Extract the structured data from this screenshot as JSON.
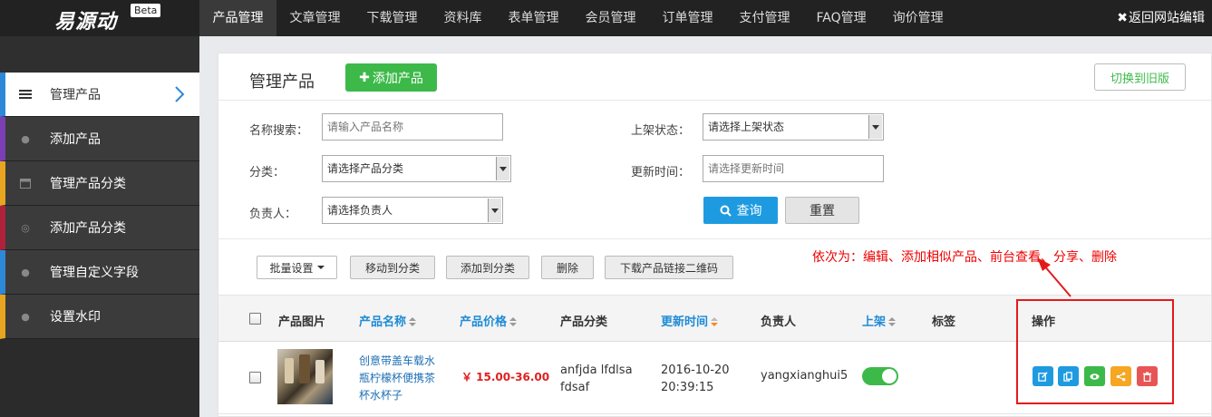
{
  "app": {
    "logo_text": "易源动",
    "logo_badge": "Beta",
    "top_nav": [
      "产品管理",
      "文章管理",
      "下载管理",
      "资料库",
      "表单管理",
      "会员管理",
      "订单管理",
      "支付管理",
      "FAQ管理",
      "询价管理"
    ],
    "back_link": "返回网站编辑"
  },
  "sidebar": {
    "items": [
      {
        "label": "管理产品",
        "icon": "list-icon",
        "accent": "#2d89d8"
      },
      {
        "label": "添加产品",
        "icon": "globe-icon",
        "accent": "#7b3fb5"
      },
      {
        "label": "管理产品分类",
        "icon": "calendar-icon",
        "accent": "#e8a520"
      },
      {
        "label": "添加产品分类",
        "icon": "target-icon",
        "accent": "#b0213c"
      },
      {
        "label": "管理自定义字段",
        "icon": "globe-icon",
        "accent": "#2d89d8"
      },
      {
        "label": "设置水印",
        "icon": "globe-icon",
        "accent": "#e8a520"
      }
    ]
  },
  "main": {
    "title": "管理产品",
    "add_button": "添加产品",
    "old_version_button": "切换到旧版",
    "filters": {
      "name_label": "名称搜索：",
      "name_placeholder": "请输入产品名称",
      "status_label": "上架状态：",
      "status_value": "请选择上架状态",
      "category_label": "分类：",
      "category_value": "请选择产品分类",
      "updated_label": "更新时间：",
      "updated_placeholder": "请选择更新时间",
      "owner_label": "负责人：",
      "owner_value": "请选择负责人",
      "query_button": "查询",
      "reset_button": "重置"
    },
    "toolbar": {
      "batch": "批量设置",
      "move": "移动到分类",
      "add_to": "添加到分类",
      "delete": "删除",
      "download_qr": "下载产品链接二维码"
    },
    "annotation": "依次为：编辑、添加相似产品、前台查看、分享、删除",
    "table": {
      "columns": [
        "产品图片",
        "产品名称",
        "产品价格",
        "产品分类",
        "更新时间",
        "负责人",
        "上架",
        "标签",
        "操作"
      ],
      "rows": [
        {
          "name": "创意带盖车载水瓶柠檬杯便携茶杯水杯子",
          "price": "￥ 15.00-36.00",
          "category": "anfjda lfdlsa fdsaf",
          "updated": "2016-10-20 20:39:15",
          "owner": "yangxianghui5",
          "listed": true,
          "tags": ""
        }
      ]
    },
    "actions": [
      {
        "icon": "edit-icon",
        "color": "#1e9be0"
      },
      {
        "icon": "copy-icon",
        "color": "#1e9be0"
      },
      {
        "icon": "eye-icon",
        "color": "#3db94a"
      },
      {
        "icon": "share-icon",
        "color": "#f5a623"
      },
      {
        "icon": "trash-icon",
        "color": "#e85555"
      }
    ]
  }
}
